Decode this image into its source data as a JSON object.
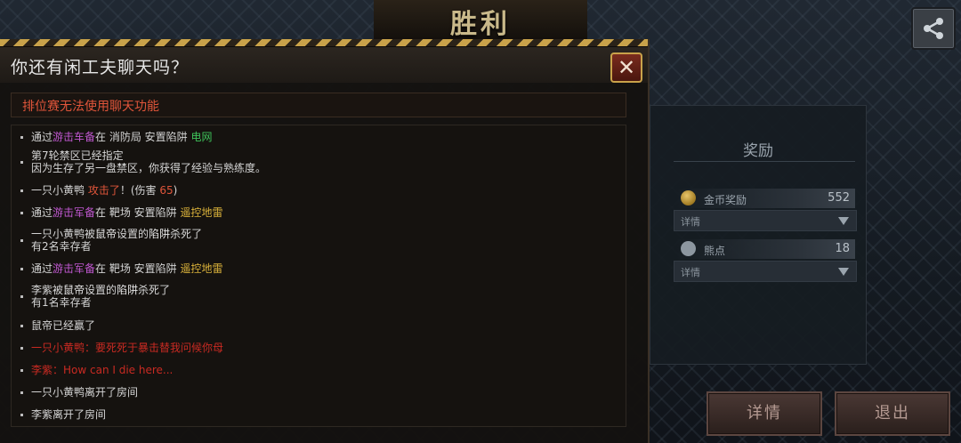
{
  "header": {
    "victory_title": "胜利"
  },
  "dialog": {
    "title": "你还有闲工夫聊天吗？",
    "close_label": "✕",
    "notice": "排位赛无法使用聊天功能"
  },
  "chat": {
    "m1": {
      "a": "通过",
      "b": "游击车备",
      "c": "在 消防局 安置陷阱 ",
      "d": "电网"
    },
    "m2": {
      "line1": "第7轮禁区已经指定",
      "line2": "因为生存了另一盘禁区，你获得了经验与熟练度。"
    },
    "m3": {
      "a": "一只小黄鸭 ",
      "b": "攻击了",
      "c": "！(伤害 ",
      "d": "65",
      "e": ")"
    },
    "m4": {
      "a": "通过",
      "b": "游击军备",
      "c": "在 靶场 安置陷阱 ",
      "d": "遥控地雷"
    },
    "m5": {
      "a": "一只小黄鸭",
      "b": "被",
      "c": "鼠帝",
      "d": "设置的",
      "e": "陷阱",
      "f": "杀死了",
      "line2": "有2名幸存者"
    },
    "m6": {
      "a": "通过",
      "b": "游击军备",
      "c": "在 靶场 安置陷阱 ",
      "d": "遥控地雷"
    },
    "m7": {
      "a": "李紫",
      "b": "被",
      "c": "鼠帝",
      "d": "设置的",
      "e": "陷阱",
      "f": "杀死了",
      "line2": "有1名幸存者"
    },
    "m8": {
      "a": "鼠帝已经赢了"
    },
    "m9": {
      "a": "一只小黄鸭：要死死于暴击替我问候你母"
    },
    "m10": {
      "a": "李紫：How can I die here..."
    },
    "m11": {
      "a": "一只小黄鸭离开了房间"
    },
    "m12": {
      "a": "李紫离开了房间"
    }
  },
  "reward": {
    "title": "奖励",
    "gold_label": "金币奖励",
    "gold_value": "552",
    "gold_detail": "详情",
    "bear_label": "熊点",
    "bear_value": "18",
    "bear_detail": "详情"
  },
  "buttons": {
    "details": "详情",
    "exit": "退出"
  },
  "icons": {
    "share": "share-icon",
    "gold": "gold-coin-icon",
    "bear": "bear-point-icon"
  }
}
